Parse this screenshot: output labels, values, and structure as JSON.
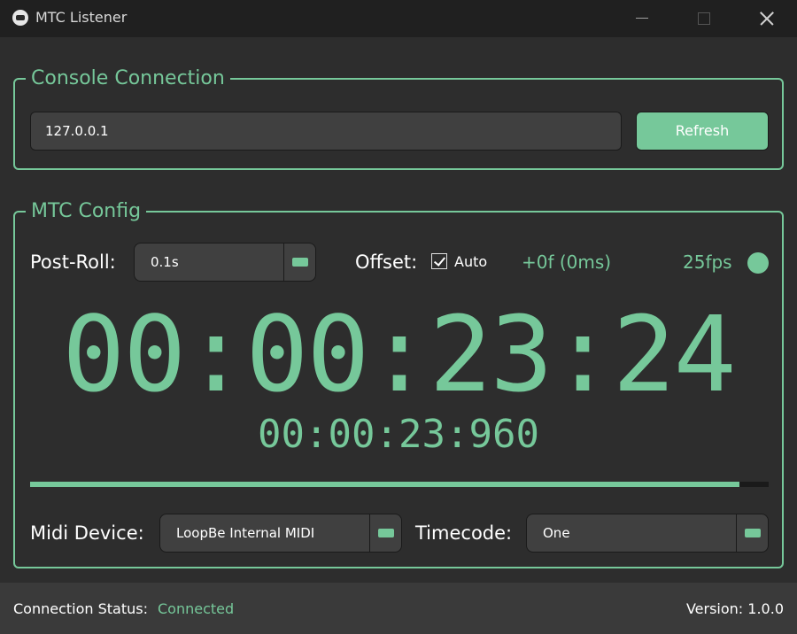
{
  "window": {
    "title": "MTC Listener"
  },
  "console_connection": {
    "legend": "Console Connection",
    "ip_value": "127.0.0.1",
    "refresh_label": "Refresh"
  },
  "mtc_config": {
    "legend": "MTC Config",
    "post_roll_label": "Post-Roll:",
    "post_roll_value": "0.1s",
    "offset_label": "Offset:",
    "auto_label": "Auto",
    "auto_checked": true,
    "offset_value": "+0f (0ms)",
    "fps_label": "25fps",
    "timecode_main": "00:00:23:24",
    "timecode_sub": "00:00:23:960",
    "progress_fraction": 0.96,
    "midi_device_label": "Midi Device:",
    "midi_device_value": "LoopBe Internal MIDI",
    "timecode_label": "Timecode:",
    "timecode_value": "One"
  },
  "status_bar": {
    "connection_label": "Connection Status:",
    "connection_value": "Connected",
    "version": "Version: 1.0.0"
  },
  "colors": {
    "accent": "#76c89a",
    "background": "#2d2d2d",
    "titlebar": "#202020",
    "statusbar": "#3a3a3a",
    "input_bg": "#404040"
  },
  "icons": [
    "app-logo-icon",
    "minimize-icon",
    "maximize-icon",
    "close-icon",
    "checkbox-check-icon",
    "status-dot-icon",
    "dropdown-arrow-icon"
  ]
}
